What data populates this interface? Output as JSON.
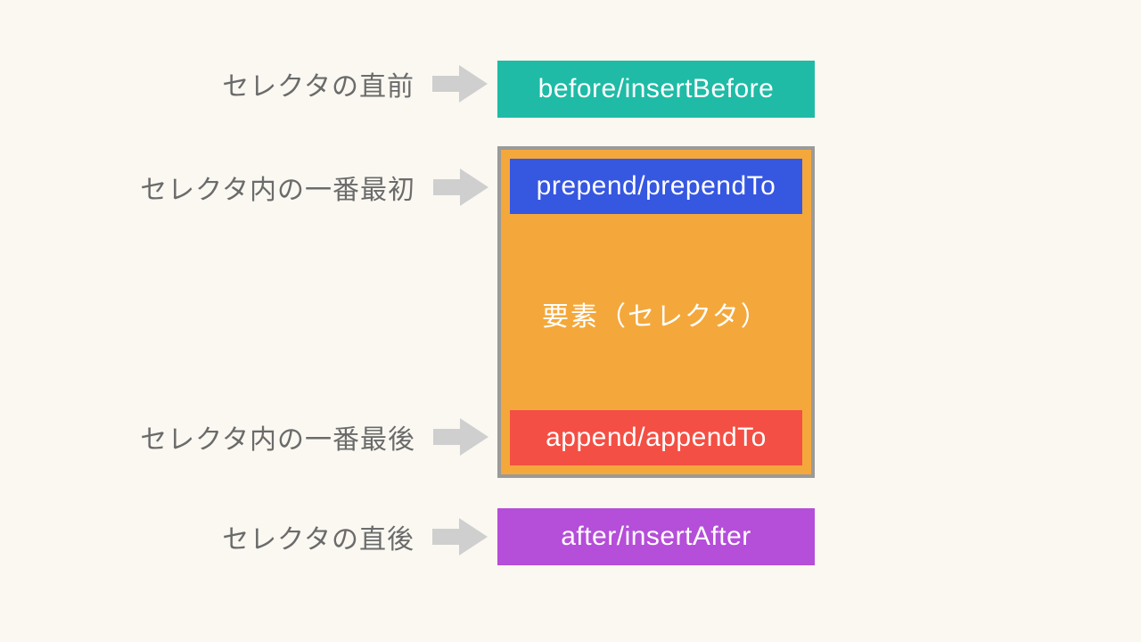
{
  "rows": {
    "before": {
      "label": "セレクタの直前",
      "box": "before/insertBefore"
    },
    "prepend": {
      "label": "セレクタ内の一番最初",
      "box": "prepend/prependTo"
    },
    "append": {
      "label": "セレクタ内の一番最後",
      "box": "append/appendTo"
    },
    "after": {
      "label": "セレクタの直後",
      "box": "after/insertAfter"
    }
  },
  "selector_label": "要素（セレクタ）",
  "colors": {
    "before": "#1fbba6",
    "prepend": "#3657e0",
    "append": "#f44f44",
    "after": "#b54ed8",
    "selector_bg": "#f4a83b",
    "selector_border": "#9a9a9a",
    "arrow": "#cfcfcf",
    "label_text": "#6b6b6b",
    "page_bg": "#faf8f1"
  }
}
